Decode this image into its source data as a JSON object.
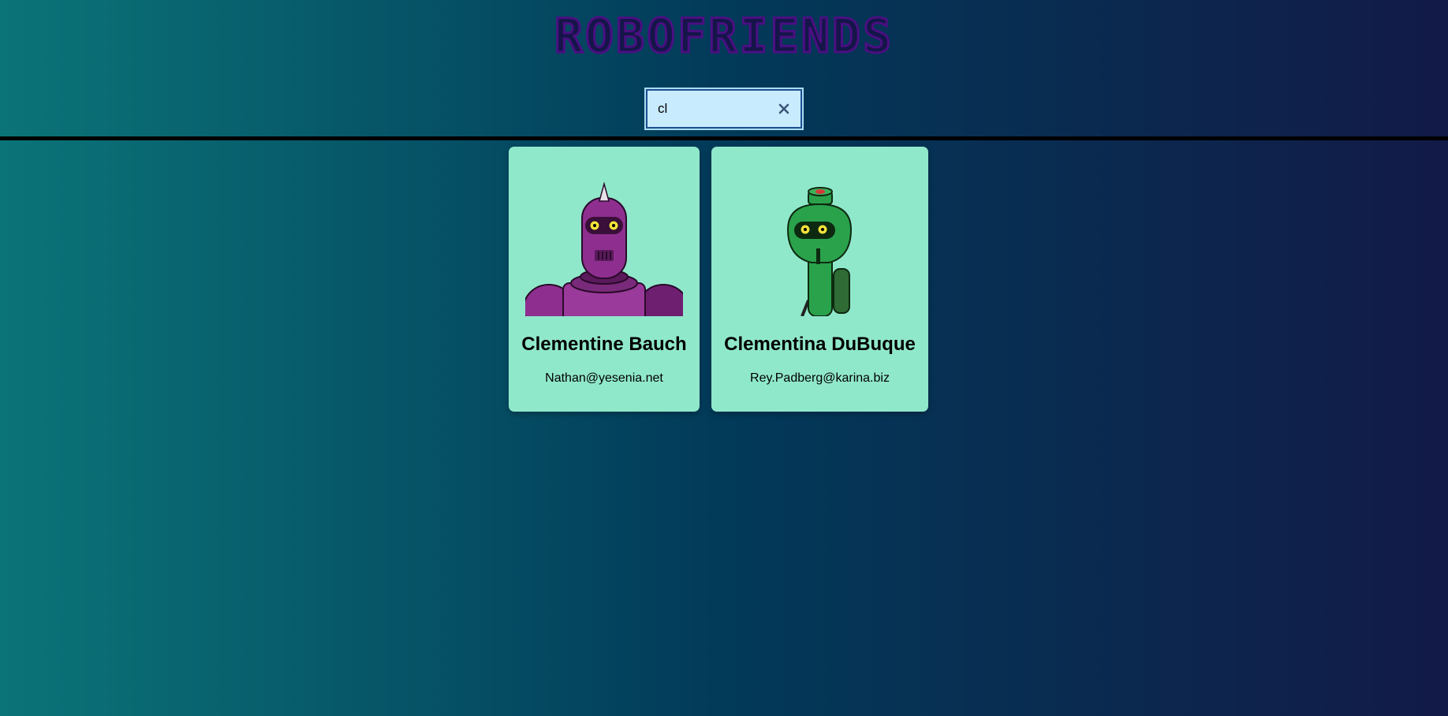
{
  "header": {
    "title": "ROBOFRIENDS"
  },
  "search": {
    "value": "cl",
    "clear_icon": "close-icon"
  },
  "robots": [
    {
      "name": "Clementine Bauch",
      "email": "Nathan@yesenia.net",
      "color": "#8c2f8c"
    },
    {
      "name": "Clementina DuBuque",
      "email": "Rey.Padberg@karina.biz",
      "color": "#22a04a"
    }
  ],
  "colors": {
    "card_background": "#90e8cb",
    "title_stroke": "#4a0f82",
    "search_background": "#c8ebfd"
  }
}
